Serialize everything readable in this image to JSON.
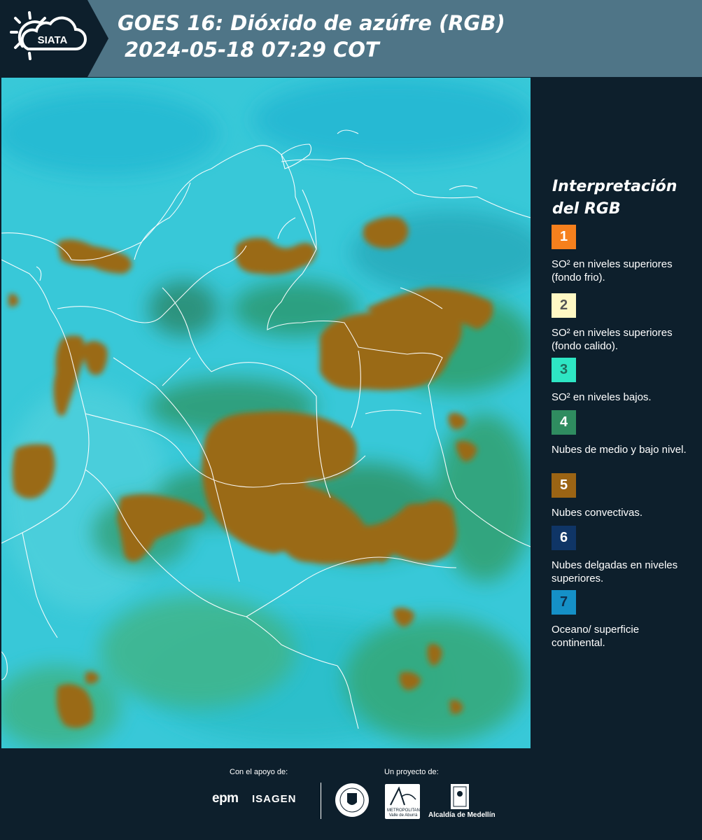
{
  "header": {
    "logo_text": "SIATA",
    "title_line1": "GOES 16: Dióxido de azúfre (RGB)",
    "title_line2": "2024-05-18 07:29 COT"
  },
  "map": {
    "description_colors": {
      "ocean_background": "#35c6d8",
      "deep_cyan": "#19b4cf",
      "green_clouds": "#2f9d6a",
      "convective_brown": "#9a6b16",
      "borders": "#ffffff"
    }
  },
  "legend": {
    "title": "Interpretación del RGB",
    "items": [
      {
        "number": "1",
        "label": "SO² en niveles superiores (fondo frio).",
        "color": "#f6801d",
        "number_color": "#ffffff"
      },
      {
        "number": "2",
        "label": "SO² en niveles superiores (fondo calido).",
        "color": "#fff8c4",
        "number_color": "#555555"
      },
      {
        "number": "3",
        "label": "SO² en niveles bajos.",
        "color": "#2ee6c4",
        "number_color": "#1f6b5c"
      },
      {
        "number": "4",
        "label": "Nubes de medio y bajo nivel.",
        "color": "#2f8c60",
        "number_color": "#ffffff"
      },
      {
        "number": "5",
        "label": "Nubes convectivas.",
        "color": "#9b6414",
        "number_color": "#ffffff"
      },
      {
        "number": "6",
        "label": "Nubes delgadas en niveles superiores.",
        "color": "#0f3566",
        "number_color": "#ffffff"
      },
      {
        "number": "7",
        "label": "Oceano/ superficie continental.",
        "color": "#1590c7",
        "number_color": "#0d2f4f"
      }
    ]
  },
  "footer": {
    "support_label": "Con el apoyo de:",
    "project_label": "Un proyecto de:",
    "epm": "epm",
    "isagen": "ISAGEN",
    "area_text": "METROPOLITANA Valle de Aburrá",
    "alcaldia": "Alcaldía de Medellín"
  }
}
